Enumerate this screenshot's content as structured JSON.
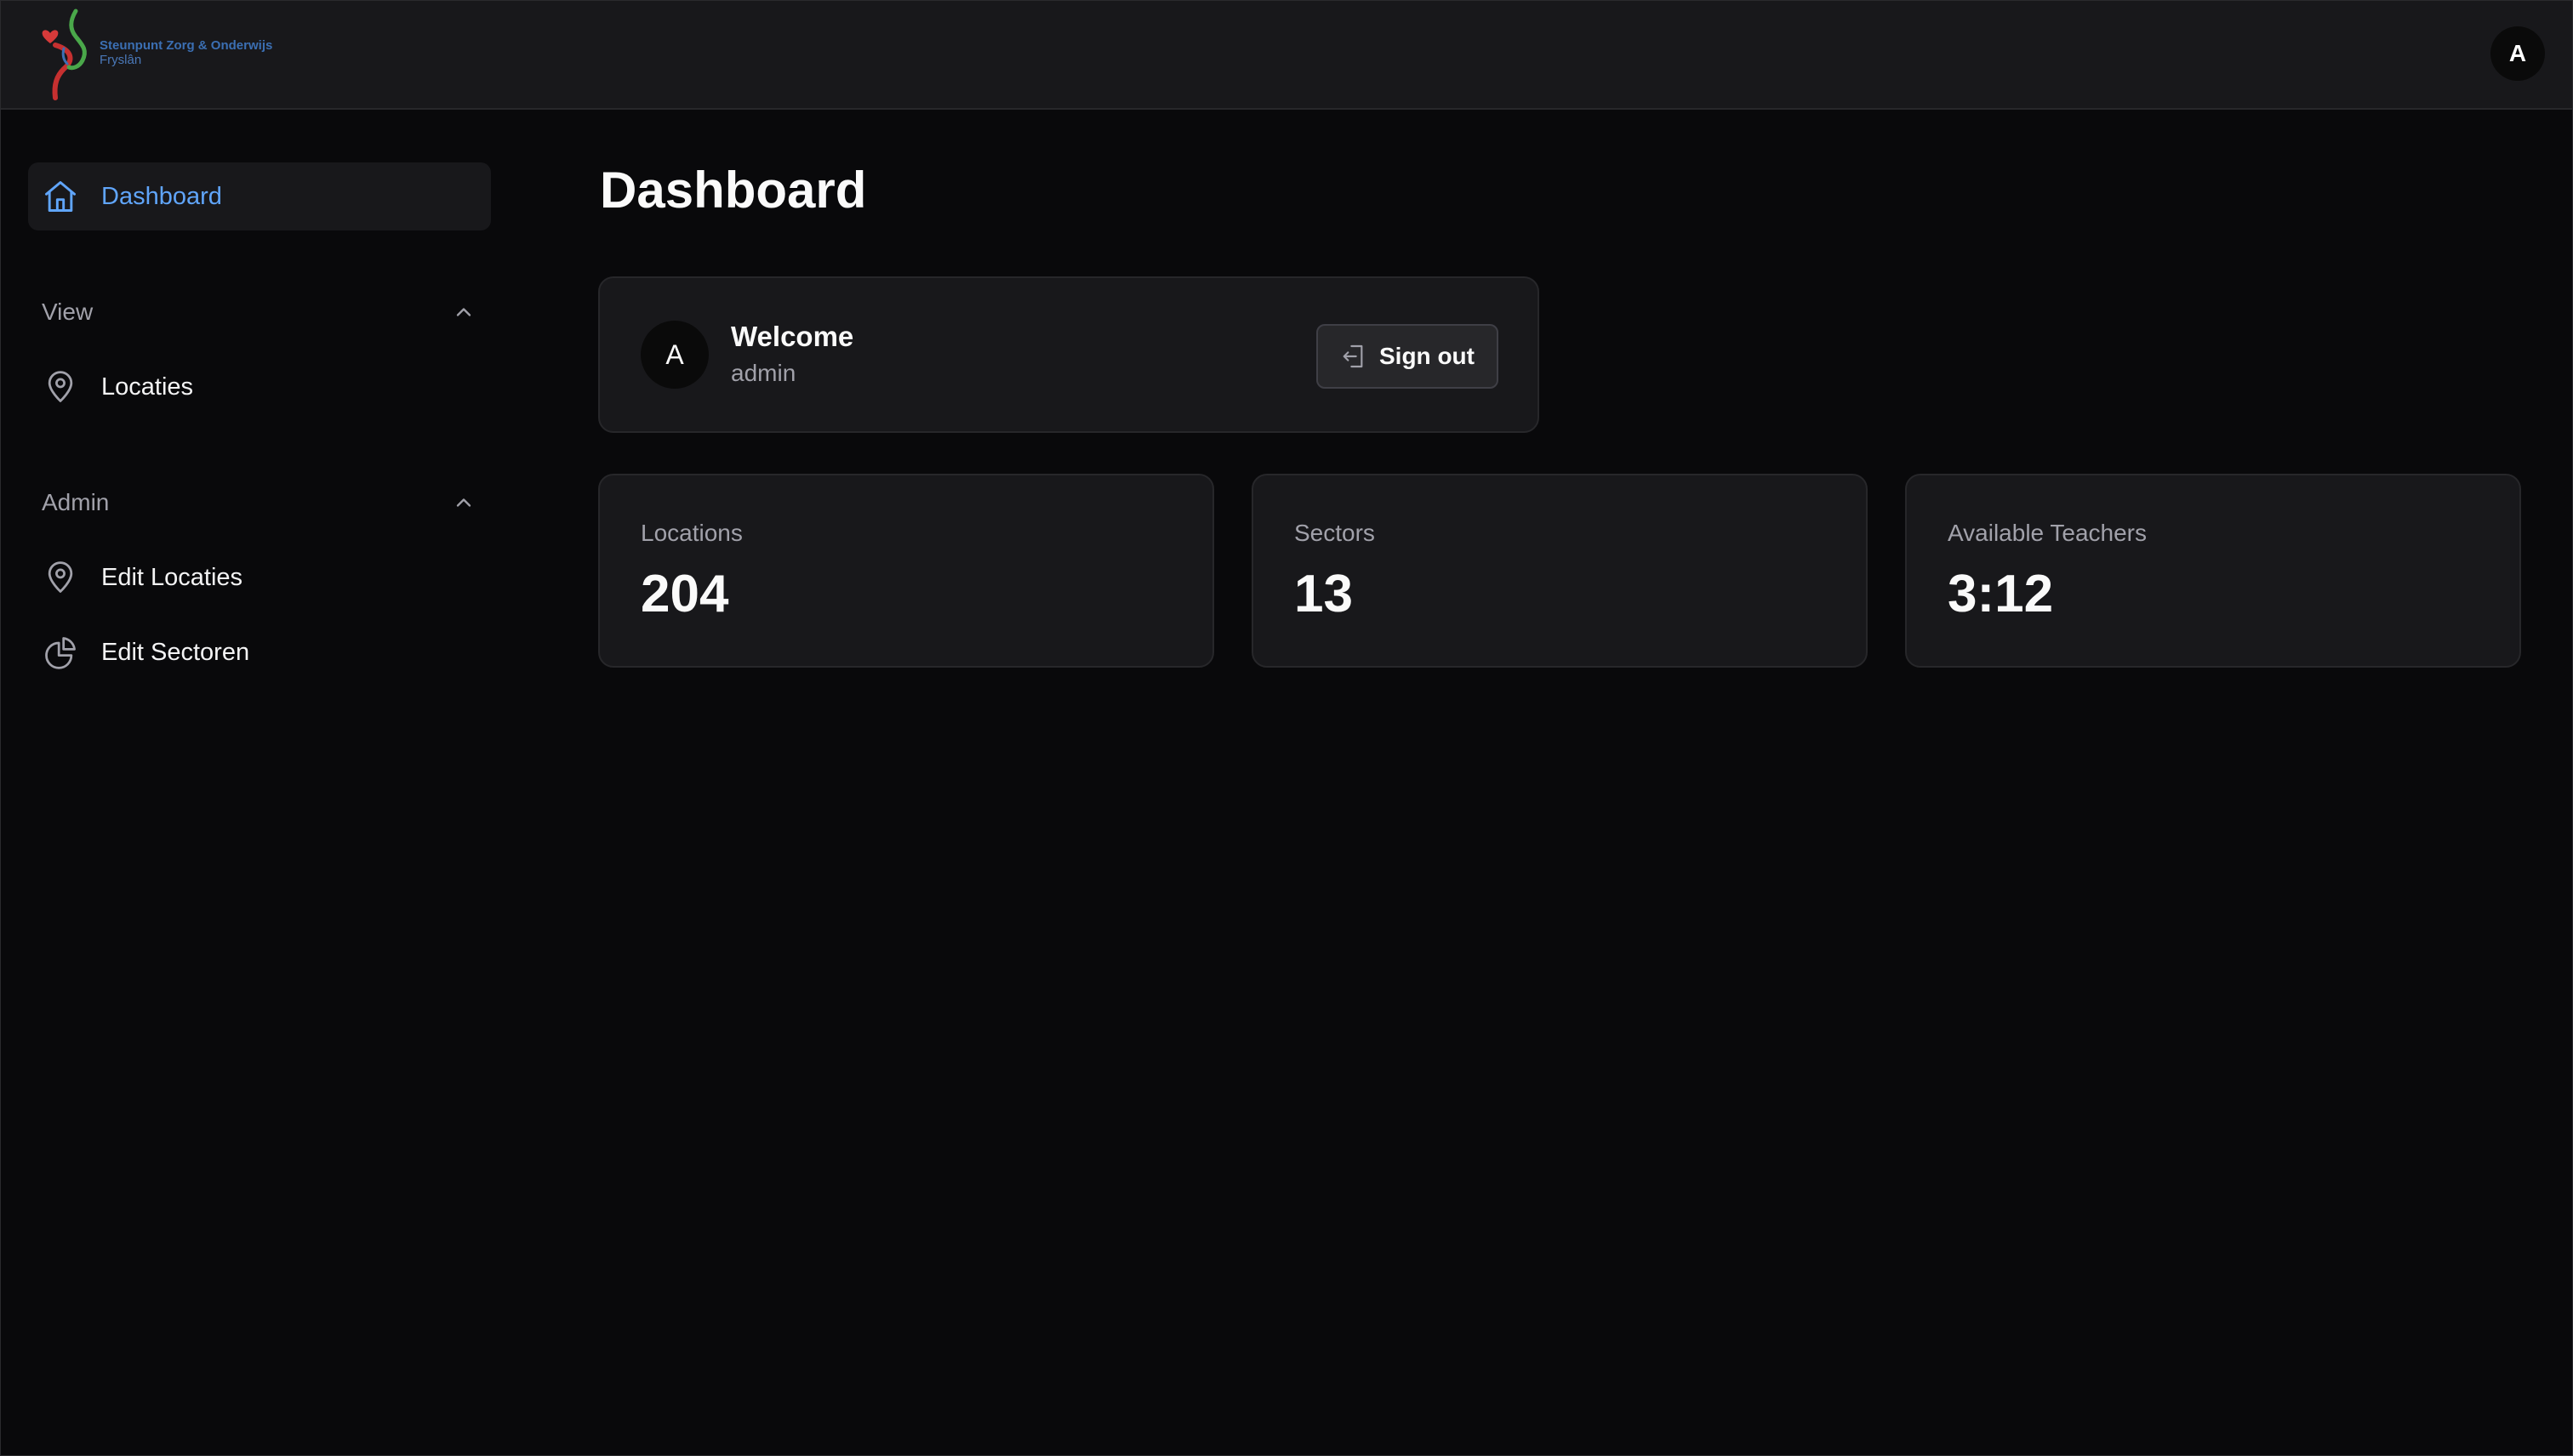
{
  "header": {
    "logo_line1": "Steunpunt Zorg & Onderwijs",
    "logo_line2": "Fryslân",
    "user_avatar_initial": "A"
  },
  "sidebar": {
    "dashboard_label": "Dashboard",
    "sections": [
      {
        "title": "View",
        "items": [
          {
            "label": "Locaties",
            "icon": "map-pin-icon"
          }
        ]
      },
      {
        "title": "Admin",
        "items": [
          {
            "label": "Edit Locaties",
            "icon": "map-pin-icon"
          },
          {
            "label": "Edit Sectoren",
            "icon": "pie-chart-icon"
          }
        ]
      }
    ]
  },
  "main": {
    "page_title": "Dashboard",
    "welcome": {
      "avatar_initial": "A",
      "title": "Welcome",
      "username": "admin",
      "signout_label": "Sign out"
    },
    "stats": [
      {
        "label": "Locations",
        "value": "204"
      },
      {
        "label": "Sectors",
        "value": "13"
      },
      {
        "label": "Available Teachers",
        "value": "3:12"
      }
    ]
  },
  "colors": {
    "background": "#09090b",
    "card": "#18181b",
    "border": "#27272a",
    "accent": "#60a5fa",
    "muted_text": "#a1a1aa"
  }
}
